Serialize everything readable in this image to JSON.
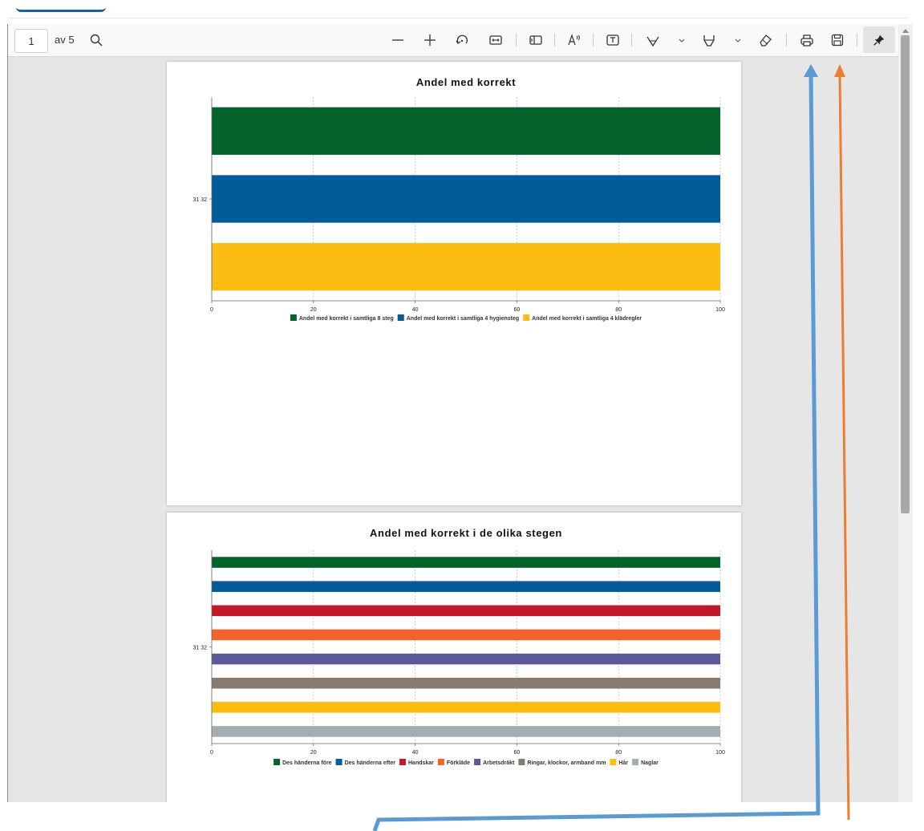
{
  "toolbar": {
    "page_number": "1",
    "page_count_label": "av 5",
    "icons": [
      "search-icon",
      "zoom-out-icon",
      "zoom-in-icon",
      "rotate-icon",
      "fit-width-icon",
      "page-view-icon",
      "read-aloud-icon",
      "text-box-icon",
      "draw-icon",
      "chevron-down-icon",
      "highlight-icon",
      "chevron-down-icon",
      "eraser-icon",
      "print-icon",
      "save-icon",
      "pin-icon"
    ]
  },
  "chart_data": [
    {
      "type": "bar",
      "orientation": "horizontal",
      "title": "Andel med korrekt",
      "categories": [
        "31 32"
      ],
      "xlim": [
        0,
        100
      ],
      "xticks": [
        "0",
        "20",
        "40",
        "60",
        "80",
        "100"
      ],
      "grid": true,
      "legend_position": "bottom",
      "series": [
        {
          "name": "Andel med korrekt i samtliga 8 steg",
          "color": "#03632a",
          "values": [
            100
          ]
        },
        {
          "name": "Andel med korrekt i samtliga 4 hygiensteg",
          "color": "#045b9a",
          "values": [
            100
          ]
        },
        {
          "name": "Andel med korrekt i samtliga 4 klädregler",
          "color": "#fcbc11",
          "values": [
            100
          ]
        }
      ]
    },
    {
      "type": "bar",
      "orientation": "horizontal",
      "title": "Andel med korrekt i de olika stegen",
      "categories": [
        "31 32"
      ],
      "xlim": [
        0,
        100
      ],
      "xticks": [
        "0",
        "20",
        "40",
        "60",
        "80",
        "100"
      ],
      "grid": true,
      "legend_position": "bottom",
      "series": [
        {
          "name": "Des händerna före",
          "color": "#03632a",
          "values": [
            100
          ]
        },
        {
          "name": "Des händerna efter",
          "color": "#045b9a",
          "values": [
            100
          ]
        },
        {
          "name": "Handskar",
          "color": "#c1182a",
          "values": [
            100
          ]
        },
        {
          "name": "Förkläde",
          "color": "#f4632c",
          "values": [
            100
          ]
        },
        {
          "name": "Arbetsdräkt",
          "color": "#5a5a9a",
          "values": [
            100
          ]
        },
        {
          "name": "Ringar, klockor, armband mm",
          "color": "#857c6f",
          "values": [
            100
          ]
        },
        {
          "name": "Hår",
          "color": "#fcbc11",
          "values": [
            100
          ]
        },
        {
          "name": "Naglar",
          "color": "#a3aeb4",
          "values": [
            100
          ]
        }
      ]
    }
  ],
  "annotation_colors": {
    "print_arrow": "#5b9bd5",
    "save_arrow": "#ed7d31"
  }
}
